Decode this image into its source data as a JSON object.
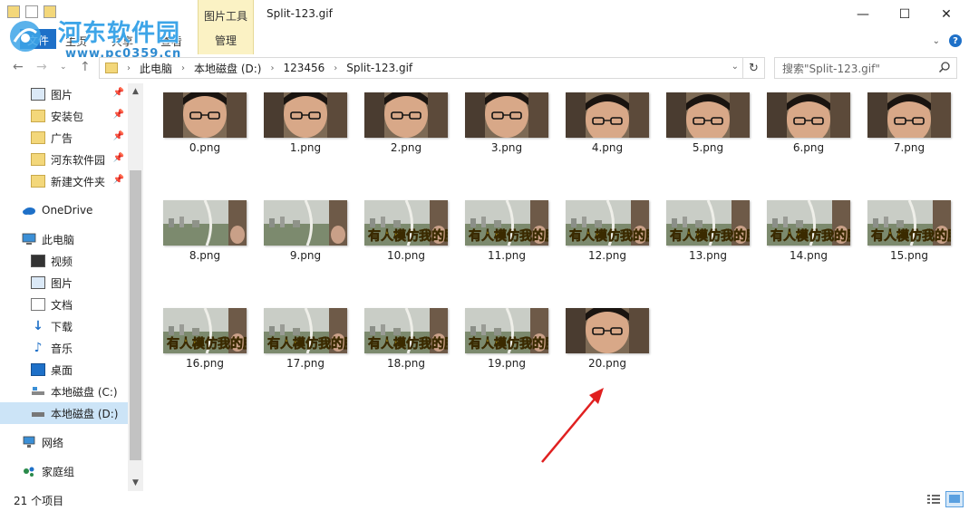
{
  "window": {
    "title": "Split-123.gif",
    "minimize_glyph": "—",
    "maximize_glyph": "☐",
    "close_glyph": "✕"
  },
  "ribbon": {
    "tool_tab": "图片工具",
    "tool_subtab": "管理",
    "tabs": [
      "主页",
      "共享",
      "查看"
    ],
    "file_tab": "文件"
  },
  "watermark": {
    "title": "河东软件园",
    "url": "www.pc0359.cn"
  },
  "address": {
    "segments": [
      "此电脑",
      "本地磁盘 (D:)",
      "123456",
      "Split-123.gif"
    ]
  },
  "search": {
    "placeholder": "搜索\"Split-123.gif\""
  },
  "sidebar": {
    "quick_access": [
      {
        "label": "图片",
        "icon": "pictures-icon"
      },
      {
        "label": "安装包",
        "icon": "folder-icon"
      },
      {
        "label": "广告",
        "icon": "folder-icon"
      },
      {
        "label": "河东软件园",
        "icon": "folder-icon"
      },
      {
        "label": "新建文件夹",
        "icon": "folder-icon"
      }
    ],
    "onedrive": "OneDrive",
    "this_pc": "此电脑",
    "pc_items": [
      {
        "label": "视频",
        "icon": "video-icon"
      },
      {
        "label": "图片",
        "icon": "pictures-icon"
      },
      {
        "label": "文档",
        "icon": "documents-icon"
      },
      {
        "label": "下载",
        "icon": "downloads-icon"
      },
      {
        "label": "音乐",
        "icon": "music-icon"
      },
      {
        "label": "桌面",
        "icon": "desktop-icon"
      },
      {
        "label": "本地磁盘 (C:)",
        "icon": "drive-c-icon"
      },
      {
        "label": "本地磁盘 (D:)",
        "icon": "drive-d-icon"
      }
    ],
    "network": "网络",
    "homegroup": "家庭组"
  },
  "files": [
    {
      "name": "0.png",
      "kind": "face"
    },
    {
      "name": "1.png",
      "kind": "face"
    },
    {
      "name": "2.png",
      "kind": "face"
    },
    {
      "name": "3.png",
      "kind": "face"
    },
    {
      "name": "4.png",
      "kind": "face2"
    },
    {
      "name": "5.png",
      "kind": "face2"
    },
    {
      "name": "6.png",
      "kind": "face2"
    },
    {
      "name": "7.png",
      "kind": "face2"
    },
    {
      "name": "8.png",
      "kind": "city"
    },
    {
      "name": "9.png",
      "kind": "city"
    },
    {
      "name": "10.png",
      "kind": "citytext"
    },
    {
      "name": "11.png",
      "kind": "citytext"
    },
    {
      "name": "12.png",
      "kind": "citytext"
    },
    {
      "name": "13.png",
      "kind": "citytext"
    },
    {
      "name": "14.png",
      "kind": "citytext"
    },
    {
      "name": "15.png",
      "kind": "citytext"
    },
    {
      "name": "16.png",
      "kind": "citytext"
    },
    {
      "name": "17.png",
      "kind": "citytext"
    },
    {
      "name": "18.png",
      "kind": "citytext"
    },
    {
      "name": "19.png",
      "kind": "citytext"
    },
    {
      "name": "20.png",
      "kind": "face"
    }
  ],
  "thumbnail_caption": "有人模仿我的脸",
  "status": {
    "item_count": "21 个项目"
  },
  "colors": {
    "accent": "#1e70c8",
    "selection": "#cce4f7",
    "annotation": "#e02020",
    "tool_tab_bg": "#fbf2c4"
  }
}
